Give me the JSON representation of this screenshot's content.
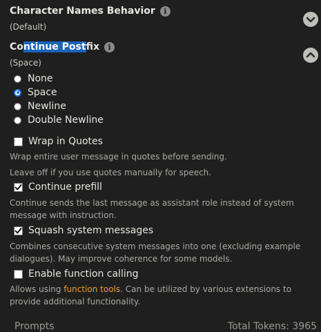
{
  "character_names": {
    "title": "Character Names Behavior",
    "value": "(Default)"
  },
  "continue_postfix": {
    "title_pre": "Co",
    "title_hl": "ntinue Post",
    "title_post": "fix",
    "value": "(Space)",
    "options": [
      "None",
      "Space",
      "Newline",
      "Double Newline"
    ],
    "selected": "Space"
  },
  "wrap_in_quotes": {
    "label": "Wrap in Quotes",
    "checked": false,
    "desc_line1": "Wrap entire user message in quotes before sending.",
    "desc_line2": "Leave off if you use quotes manually for speech."
  },
  "continue_prefill": {
    "label": "Continue prefill",
    "checked": true,
    "desc": "Continue sends the last message as assistant role instead of system message with instruction."
  },
  "squash_system": {
    "label": "Squash system messages",
    "checked": true,
    "desc": "Combines consecutive system messages into one (excluding example dialogues). May improve coherence for some models."
  },
  "function_calling": {
    "label": "Enable function calling",
    "checked": false,
    "desc_pre": "Allows using ",
    "desc_link": "function tools",
    "desc_post": ". Can be utilized by various extensions to provide additional functionality."
  },
  "footer": {
    "left": "Prompts",
    "right": "Total Tokens: 3965"
  },
  "icons": {
    "info": "info-icon",
    "chevron_down": "chevron-down-icon",
    "chevron_up": "chevron-up-icon"
  },
  "colors": {
    "background": "#1f1f1f",
    "selection": "#1b63b8",
    "link": "#f0a030",
    "radio_accent": "#1a73e8"
  }
}
